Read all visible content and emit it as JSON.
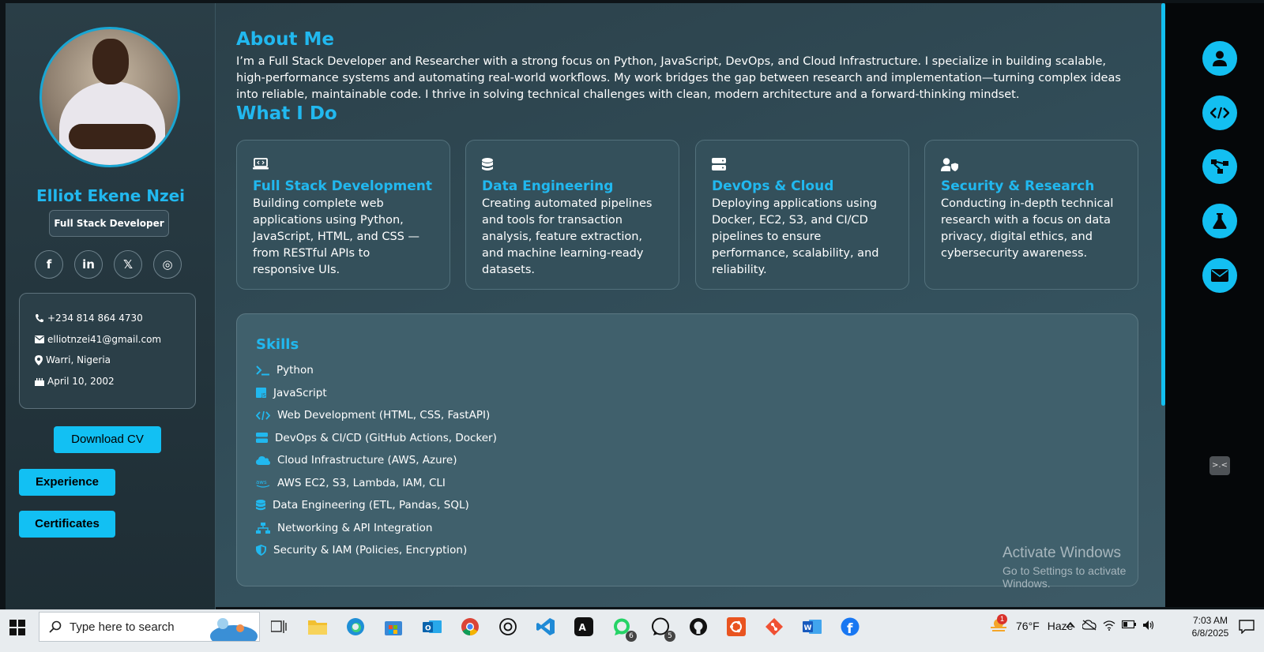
{
  "profile": {
    "name": "Elliot Ekene Nzei",
    "role": "Full Stack Developer",
    "socials": [
      {
        "icon": "facebook-icon",
        "glyph": "f"
      },
      {
        "icon": "linkedin-icon",
        "glyph": "in"
      },
      {
        "icon": "x-icon",
        "glyph": "𝕏"
      },
      {
        "icon": "instagram-icon",
        "glyph": "◎"
      }
    ],
    "contact": {
      "phone": "+234 814 864 4730",
      "email": "elliotnzei41@gmail.com",
      "location": "Warri, Nigeria",
      "birthday": "April 10, 2002"
    },
    "buttons": {
      "download_cv": "Download CV",
      "experience": "Experience",
      "certificates": "Certificates"
    }
  },
  "about": {
    "title": "About Me",
    "text": "I’m a Full Stack Developer and Researcher with a strong focus on Python, JavaScript, DevOps, and Cloud Infrastructure. I specialize in building scalable, high-performance systems and automating real-world workflows. My work bridges the gap between research and implementation—turning complex ideas into reliable, maintainable code. I thrive in solving technical challenges with clean, modern architecture and a forward-thinking mindset."
  },
  "what_i_do": {
    "title": "What I Do",
    "cards": [
      {
        "icon": "laptop-code-icon",
        "title": "Full Stack Development",
        "desc": "Building complete web applications using Python, JavaScript, HTML, and CSS — from RESTful APIs to responsive UIs."
      },
      {
        "icon": "database-icon",
        "title": "Data Engineering",
        "desc": "Creating automated pipelines and tools for transaction analysis, feature extraction, and machine learning-ready datasets."
      },
      {
        "icon": "server-icon",
        "title": "DevOps & Cloud",
        "desc": "Deploying applications using Docker, EC2, S3, and CI/CD pipelines to ensure performance, scalability, and reliability."
      },
      {
        "icon": "user-shield-icon",
        "title": "Security & Research",
        "desc": "Conducting in-depth technical research with a focus on data privacy, digital ethics, and cybersecurity awareness."
      }
    ]
  },
  "skills": {
    "title": "Skills",
    "items": [
      {
        "icon": "terminal-icon",
        "label": "Python"
      },
      {
        "icon": "js-icon",
        "label": "JavaScript"
      },
      {
        "icon": "code-icon",
        "label": "Web Development (HTML, CSS, FastAPI)"
      },
      {
        "icon": "server-icon",
        "label": "DevOps & CI/CD (GitHub Actions, Docker)"
      },
      {
        "icon": "cloud-icon",
        "label": "Cloud Infrastructure (AWS, Azure)"
      },
      {
        "icon": "aws-icon",
        "label": "AWS EC2, S3, Lambda, IAM, CLI"
      },
      {
        "icon": "database-icon",
        "label": "Data Engineering (ETL, Pandas, SQL)"
      },
      {
        "icon": "network-icon",
        "label": "Networking & API Integration"
      },
      {
        "icon": "shield-icon",
        "label": "Security & IAM (Policies, Encryption)"
      }
    ]
  },
  "right_nav": [
    {
      "icon": "user-icon"
    },
    {
      "icon": "code-icon"
    },
    {
      "icon": "project-diagram-icon"
    },
    {
      "icon": "flask-icon"
    },
    {
      "icon": "envelope-icon"
    }
  ],
  "watermark": {
    "line1": "Activate Windows",
    "line2": "Go to Settings to activate Windows."
  },
  "taskbar": {
    "search_placeholder": "Type here to search",
    "weather_temp": "76°F",
    "weather_desc": "Haze",
    "weather_badge": "1",
    "time": "7:03 AM",
    "date": "6/8/2025",
    "badges": {
      "whatsapp": "6",
      "whatsapp_web": "5"
    }
  },
  "colors": {
    "accent": "#21b8ef",
    "button": "#12c0f3"
  }
}
